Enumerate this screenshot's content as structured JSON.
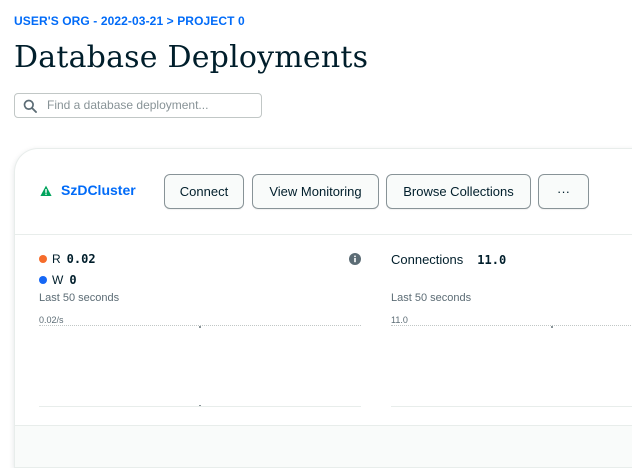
{
  "breadcrumb": {
    "org": "USER'S ORG - 2022-03-21",
    "separator": ">",
    "project": "PROJECT 0"
  },
  "page": {
    "title": "Database Deployments"
  },
  "search": {
    "placeholder": "Find a database deployment...",
    "value": "",
    "icon": "search-icon"
  },
  "cluster": {
    "name": "SzDCluster",
    "status_icon": "warning-triangle-icon",
    "status_color": "#00a35c",
    "buttons": {
      "connect": "Connect",
      "view_monitoring": "View Monitoring",
      "browse_collections": "Browse Collections",
      "more": "···"
    }
  },
  "metrics": {
    "operations": {
      "read_key": "R",
      "read_value": "0.02",
      "read_color": "#f66c2b",
      "write_key": "W",
      "write_value": "0",
      "write_color": "#1667f5",
      "period": "Last 50 seconds",
      "axis_max": "0.02/s",
      "info_icon": "info-icon"
    },
    "connections": {
      "label": "Connections",
      "value": "11.0",
      "period": "Last 50 seconds",
      "axis_max": "11.0"
    }
  },
  "colors": {
    "accent": "#016bf8",
    "text": "#001e2b"
  }
}
